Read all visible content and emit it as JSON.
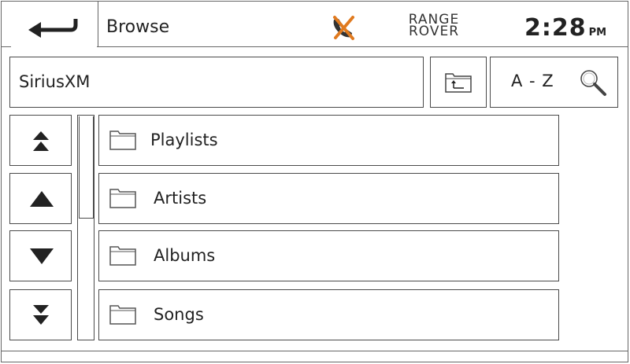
{
  "header": {
    "back_icon": "back-arrow-icon",
    "title": "Browse",
    "status_icon": "phone-disconnected-icon",
    "brand_line1": "RANGE",
    "brand_line2": "ROVER",
    "time": "2:28",
    "ampm": "PM"
  },
  "toolbar": {
    "source": "SiriusXM",
    "up_level_icon": "folder-up-icon",
    "sort_label": "A - Z",
    "search_icon": "search-icon"
  },
  "scroll_buttons": [
    {
      "name": "page-up",
      "icon": "double-up-arrow-icon"
    },
    {
      "name": "line-up",
      "icon": "up-arrow-icon"
    },
    {
      "name": "line-down",
      "icon": "down-arrow-icon"
    },
    {
      "name": "page-down",
      "icon": "double-down-arrow-icon"
    }
  ],
  "list": [
    {
      "label": "Playlists",
      "icon": "folder-icon"
    },
    {
      "label": "Artists",
      "icon": "folder-icon"
    },
    {
      "label": "Albums",
      "icon": "folder-icon"
    },
    {
      "label": "Songs",
      "icon": "folder-icon"
    }
  ],
  "colors": {
    "line": "#4a4a4a",
    "status_icon_orange": "#e07a1f",
    "status_icon_dark": "#333333"
  }
}
